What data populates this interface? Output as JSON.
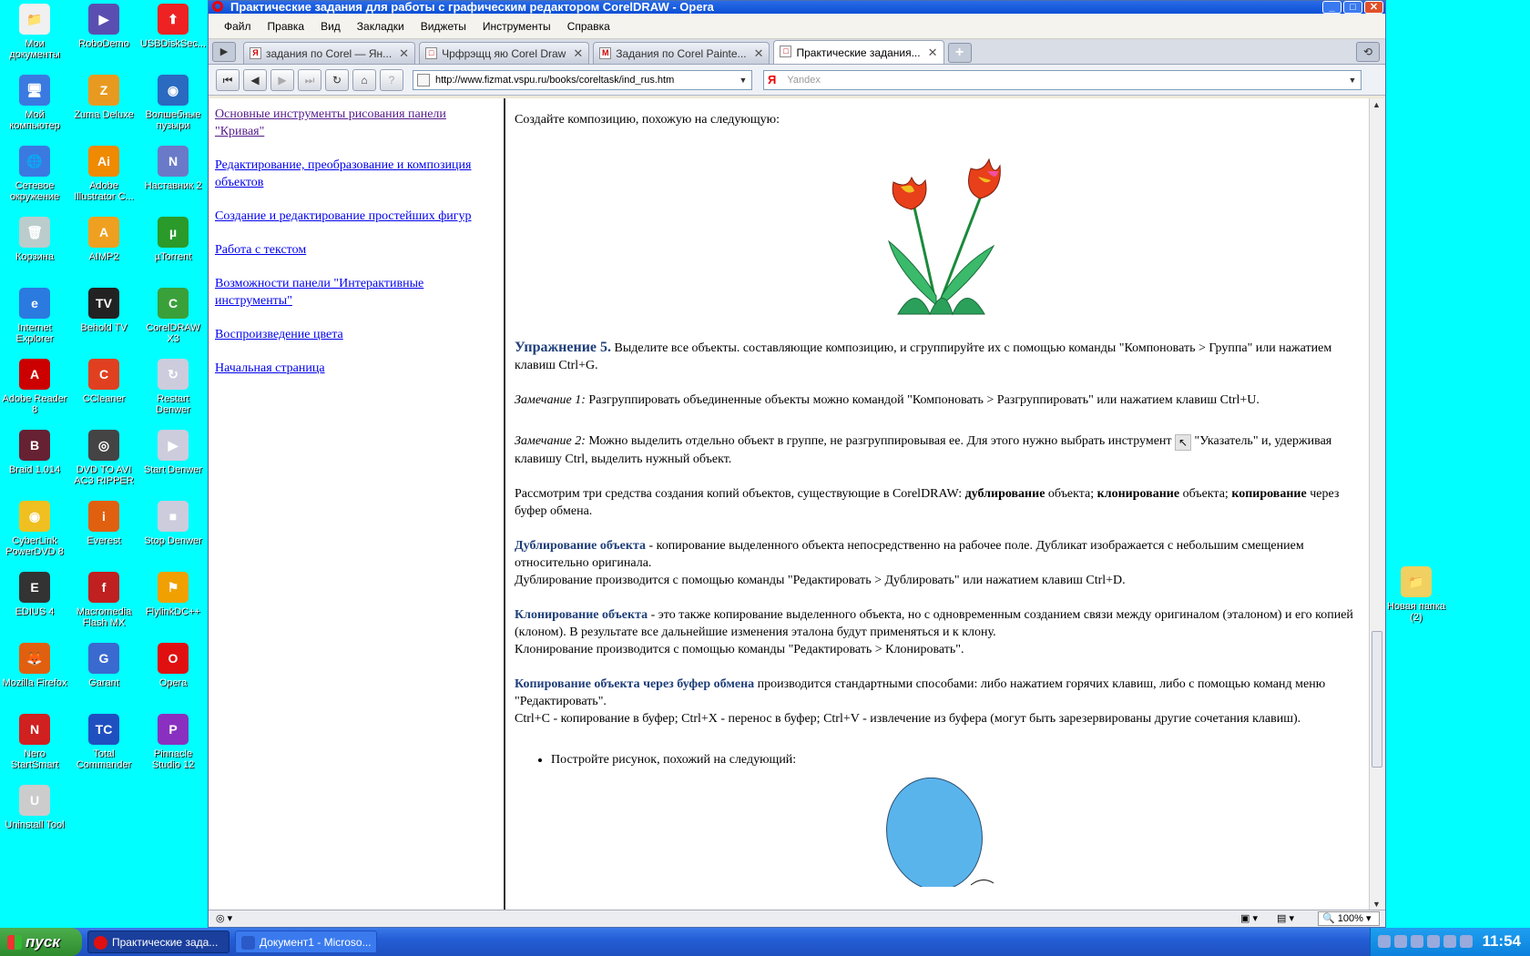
{
  "desktop": {
    "icons": [
      {
        "label": "Мои документы",
        "color": "#f0f0f0",
        "glyph": "📁"
      },
      {
        "label": "RoboDemo",
        "color": "#5a4fb0",
        "glyph": "▶"
      },
      {
        "label": "USBDiskSec...",
        "color": "#e22",
        "glyph": "⬆"
      },
      {
        "label": "Мой компьютер",
        "color": "#3a7ae0",
        "glyph": "🖥"
      },
      {
        "label": "Zuma Deluxe",
        "color": "#e89a20",
        "glyph": "Z"
      },
      {
        "label": "Волшебные пузыри",
        "color": "#2a6ac0",
        "glyph": "◉"
      },
      {
        "label": "Сетевое окружение",
        "color": "#3a7ae0",
        "glyph": "🌐"
      },
      {
        "label": "Adobe Illustrator C...",
        "color": "#f08a00",
        "glyph": "Ai"
      },
      {
        "label": "Наставник 2",
        "color": "#6a7ac8",
        "glyph": "N"
      },
      {
        "label": "Корзина",
        "color": "#bcc",
        "glyph": "🗑"
      },
      {
        "label": "AIMP2",
        "color": "#f0a020",
        "glyph": "A"
      },
      {
        "label": "µTorrent",
        "color": "#2a9a2a",
        "glyph": "µ"
      },
      {
        "label": "Internet Explorer",
        "color": "#2a7ae0",
        "glyph": "e"
      },
      {
        "label": "Behold TV",
        "color": "#222",
        "glyph": "TV"
      },
      {
        "label": "CorelDRAW X3",
        "color": "#3aa03a",
        "glyph": "C"
      },
      {
        "label": "Adobe Reader 8",
        "color": "#c00",
        "glyph": "A"
      },
      {
        "label": "CCleaner",
        "color": "#e04020",
        "glyph": "C"
      },
      {
        "label": "Restart Denwer",
        "color": "#ccd",
        "glyph": "↻"
      },
      {
        "label": "Braid 1.014",
        "color": "#623",
        "glyph": "B"
      },
      {
        "label": "DVD TO AVI AC3 RIPPER",
        "color": "#444",
        "glyph": "◎"
      },
      {
        "label": "Start Denwer",
        "color": "#ccd",
        "glyph": "▶"
      },
      {
        "label": "CyberLink PowerDVD 8",
        "color": "#f0c020",
        "glyph": "◉"
      },
      {
        "label": "Everest",
        "color": "#e06010",
        "glyph": "i"
      },
      {
        "label": "Stop Denwer",
        "color": "#ccd",
        "glyph": "■"
      },
      {
        "label": "EDIUS 4",
        "color": "#333",
        "glyph": "E"
      },
      {
        "label": "Macromedia Flash MX",
        "color": "#c02020",
        "glyph": "f"
      },
      {
        "label": "FlylinkDC++",
        "color": "#f0a000",
        "glyph": "⚑"
      },
      {
        "label": "Mozilla Firefox",
        "color": "#e06010",
        "glyph": "🦊"
      },
      {
        "label": "Garant",
        "color": "#3a6ad0",
        "glyph": "G"
      },
      {
        "label": "Opera",
        "color": "#e01010",
        "glyph": "O"
      },
      {
        "label": "Nero StartSmart",
        "color": "#d02020",
        "glyph": "N"
      },
      {
        "label": "Total Commander",
        "color": "#2050c0",
        "glyph": "TC"
      },
      {
        "label": "Pinnacle Studio 12",
        "color": "#8a30c0",
        "glyph": "P"
      },
      {
        "label": "Uninstall Tool",
        "color": "#ccc",
        "glyph": "U"
      },
      {
        "label": "Новая папка (2)",
        "color": "#f0d060",
        "glyph": "📁"
      }
    ]
  },
  "window": {
    "title": "Практические задания для работы с графическим редактором CorelDRAW - Opera",
    "menu": [
      "Файл",
      "Правка",
      "Вид",
      "Закладки",
      "Виджеты",
      "Инструменты",
      "Справка"
    ],
    "tabs": [
      {
        "label": "задания по Corel — Ян...",
        "fav": "Я"
      },
      {
        "label": "Чрфрэщц яю Corel Draw",
        "fav": "□"
      },
      {
        "label": "Задания по Corel Painte...",
        "fav": "M"
      },
      {
        "label": "Практические задания...",
        "fav": "□"
      }
    ],
    "address": "http://www.fizmat.vspu.ru/books/coreltask/ind_rus.htm",
    "search_placeholder": "Yandex",
    "search_brand": "Я",
    "zoom": "100%"
  },
  "nav": {
    "links": [
      "Основные инструменты рисования панели \"Кривая\"",
      "Редактирование, преобразование и композиция объектов",
      "Создание и редактирование простейших фигур",
      "Работа с текстом",
      "Возможности панели \"Интерактивные инструменты\"",
      "Воспроизведение цвета",
      "Начальная страница"
    ]
  },
  "main": {
    "intro": "Создайте композицию, похожую на следующую:",
    "ex5_head": "Упражнение 5.",
    "ex5_text": " Выделите все объекты. составляющие композицию, и сгруппируйте их с помощью команды \"Компоновать > Группа\" или нажатием клавиш Ctrl+G.",
    "note1_head": "Замечание 1:",
    "note1_text": " Разгруппировать объединенные объекты можно командой \"Компоновать > Разгруппировать\" или нажатием клавиш Ctrl+U.",
    "note2_head": "Замечание 2:",
    "note2_text_a": " Можно выделить отдельно объект в группе, не разгруппировывая ее. Для этого нужно выбрать инструмент ",
    "note2_text_b": " \"Указатель\" и, удерживая клавишу Ctrl, выделить нужный объект.",
    "copy_intro_a": "Рассмотрим три средства создания копий объектов, существующие в CorelDRAW: ",
    "copy_dup": "дублирование",
    "copy_mid1": " объекта; ",
    "copy_clone": "клонирование",
    "copy_mid2": " объекта; ",
    "copy_copy": "копирование",
    "copy_end": " через буфер обмена.",
    "dup_head": "Дублирование объекта",
    "dup_text": " - копирование выделенного объекта непосредственно на рабочее поле. Дубликат изображается с небольшим смещением относительно оригинала.",
    "dup_cmd": "Дублирование производится с помощью команды \"Редактировать > Дублировать\" или нажатием клавиш Ctrl+D.",
    "clone_head": "Клонирование объекта",
    "clone_text": " - это также копирование выделенного объекта, но с одновременным созданием связи между оригиналом (эталоном) и его копией (клоном). В результате все дальнейшие изменения эталона будут применяться и к клону.",
    "clone_cmd": "Клонирование производится с помощью команды \"Редактировать > Клонировать\".",
    "buf_head": "Копирование объекта через буфер обмена",
    "buf_text": " производится стандартными способами: либо нажатием горячих клавиш, либо с помощью команд меню \"Редактировать\".",
    "buf_keys": "Ctrl+C - копирование в буфер; Ctrl+X - перенос в буфер; Ctrl+V - извлечение из буфера (могут быть зарезервированы другие сочетания клавиш).",
    "task_bullet": "Постройте рисунок, похожий на следующий:"
  },
  "taskbar": {
    "start": "пуск",
    "items": [
      "Практические зада...",
      "Документ1 - Microso..."
    ],
    "clock": "11:54"
  }
}
